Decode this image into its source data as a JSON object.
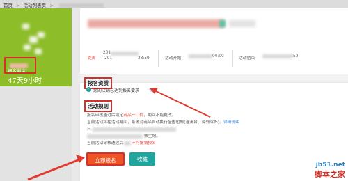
{
  "breadcrumb": {
    "home": "首页",
    "separator": ">",
    "list": "活动列表页",
    "current": ""
  },
  "sidebar": {
    "remain_label": "报名剩余",
    "remain_value": "47天9小时"
  },
  "times": {
    "status": "距离",
    "range_start": "201",
    "range_end": "-201",
    "range_end_time": "23:59",
    "start_label": "活动开始",
    "start_time": "00:00",
    "end_label": "活动结束",
    "end_time": "59"
  },
  "qualification": {
    "title": "报名资质",
    "text": "您的店铺已达到报名要求",
    "link": "详情"
  },
  "rules": {
    "title": "活动规则",
    "line1_a": "报名审核通过后锁定",
    "line1_hl": "商品一口价",
    "line1_b": "，期间不能更改。",
    "line2_a": "当前活动将在活动期间，系统对商品自动执行全国包邮(港澳台、海外除外)。",
    "line2_link": "详细说明",
    "line3_a": "只",
    "line4_a": "效生效。",
    "line5_a": "当前活动审核通过后",
    "line5_hl": "不可撤销报名"
  },
  "buttons": {
    "signup": "立即报名",
    "favorite": "收藏"
  },
  "watermark": {
    "url": "jb51.net",
    "name": "脚本之家"
  },
  "colors": {
    "sidebar_green": "#8dbd29",
    "primary_button": "#ee5525",
    "secondary_button": "#1fa59d",
    "annotation_red": "#d6302a",
    "link_blue": "#2b79c2"
  }
}
